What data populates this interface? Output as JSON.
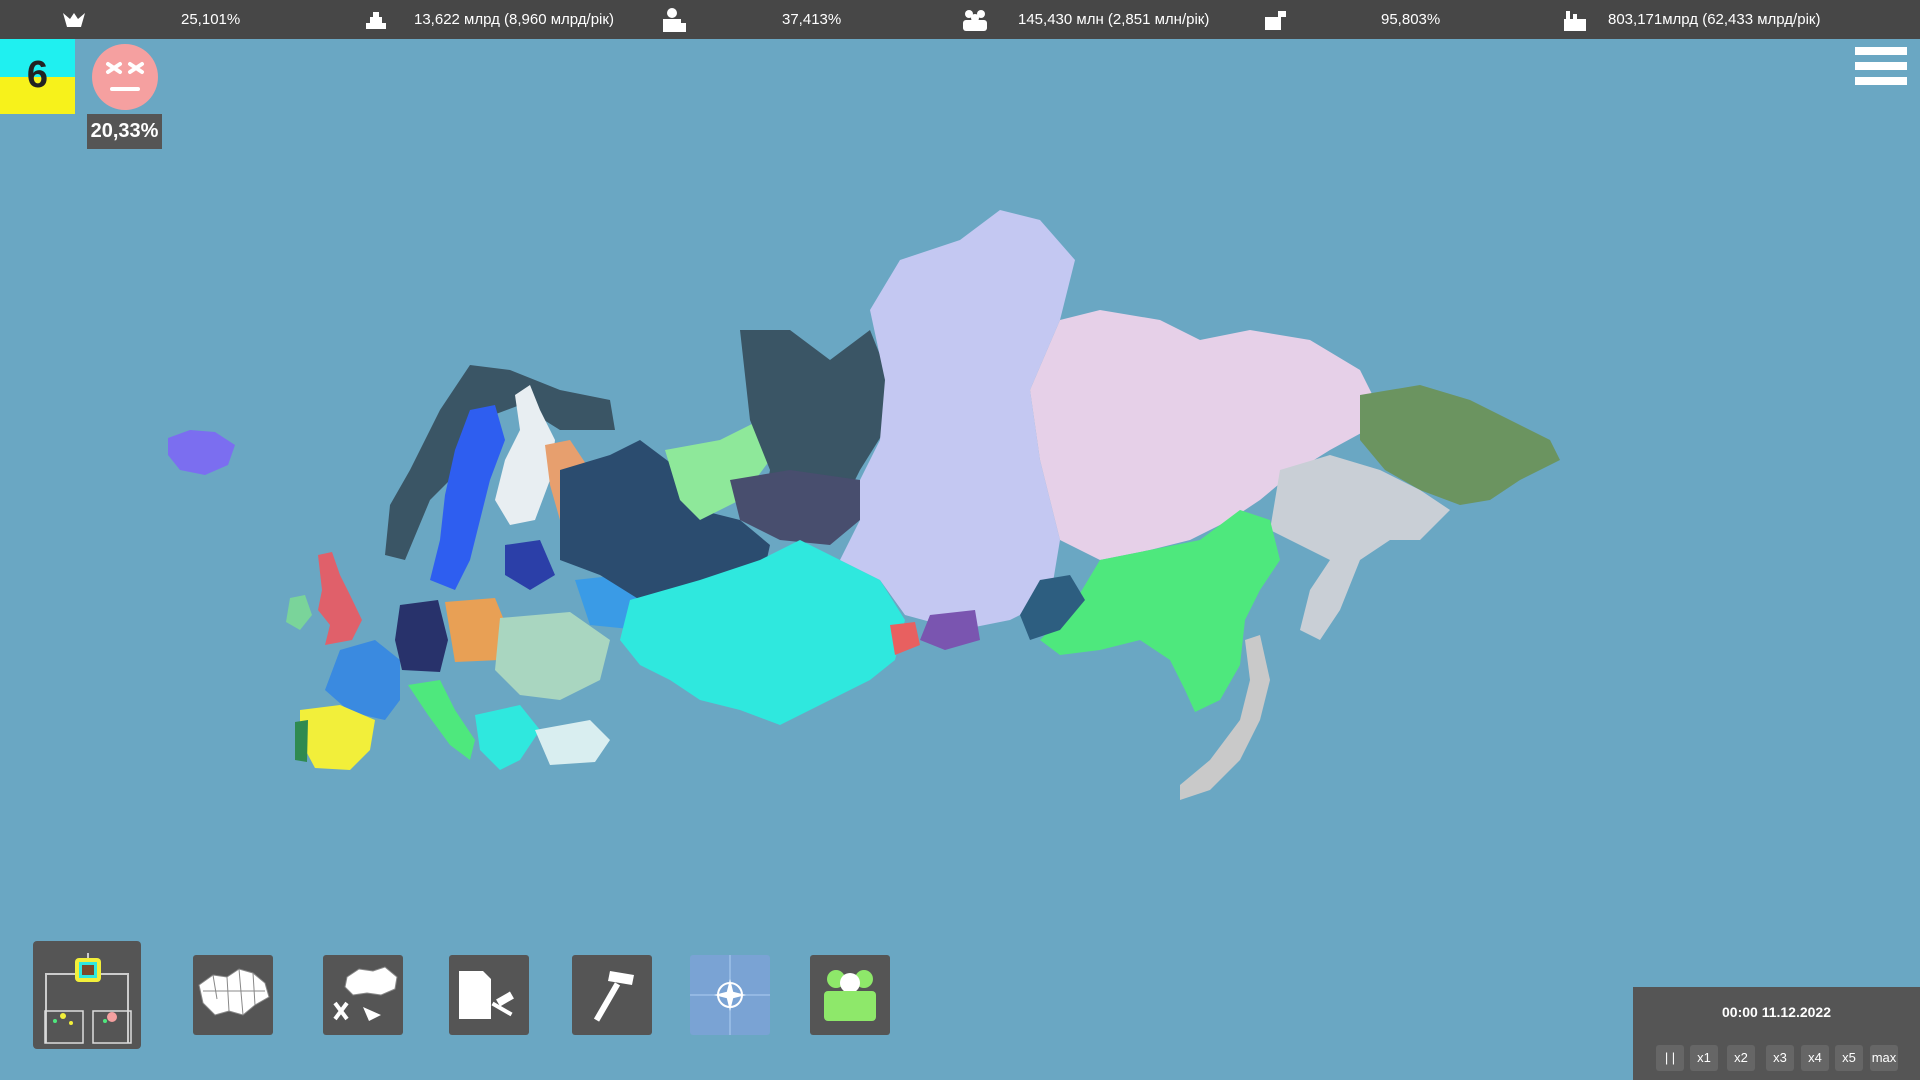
{
  "topbar": {
    "stats": [
      {
        "icon": "support-icon",
        "value": "25,101%"
      },
      {
        "icon": "budget-icon",
        "value": "13,622 млрд (8,960 млрд/рік)"
      },
      {
        "icon": "approval-icon",
        "value": "37,413%"
      },
      {
        "icon": "population-icon",
        "value": "145,430 млн (2,851 млн/рік)"
      },
      {
        "icon": "employment-icon",
        "value": "95,803%"
      },
      {
        "icon": "industry-icon",
        "value": "803,171млрд (62,433 млрд/рік)"
      }
    ]
  },
  "country": {
    "flag_number": "6",
    "flag_colors": {
      "top": "#1ff0f0",
      "bottom": "#f7f21b"
    },
    "mood_icon": "angry-face-icon",
    "unrest_percent": "20,33%"
  },
  "map": {
    "ocean_color": "#6aa7c3",
    "regions": [
      {
        "name": "russia-west",
        "color": "#2b4c6f"
      },
      {
        "name": "russia-north",
        "color": "#3a5565"
      },
      {
        "name": "russia-siberia",
        "color": "#c4c8f2"
      },
      {
        "name": "russia-east",
        "color": "#e6d0e8"
      },
      {
        "name": "kazakhstan",
        "color": "#2fe8de"
      },
      {
        "name": "chukotka",
        "color": "#6b9460"
      },
      {
        "name": "far-east-green",
        "color": "#4ee87d"
      },
      {
        "name": "scandinavia",
        "color": "#2e5ef0"
      },
      {
        "name": "iberia",
        "color": "#f2ef3a"
      },
      {
        "name": "japan",
        "color": "#c9c9c9"
      }
    ]
  },
  "toolbar": {
    "tools": [
      {
        "name": "tool-elections",
        "icon": "elections-icon"
      },
      {
        "name": "tool-regions",
        "icon": "ukraine-regions-icon"
      },
      {
        "name": "tool-region-actions",
        "icon": "regions-tools-icon"
      },
      {
        "name": "tool-laws",
        "icon": "law-gavel-icon"
      },
      {
        "name": "tool-build",
        "icon": "hammer-icon"
      },
      {
        "name": "tool-nato",
        "icon": "nato-icon"
      },
      {
        "name": "tool-people",
        "icon": "people-icon"
      }
    ]
  },
  "time": {
    "clock": "00:00 11.12.2022",
    "speeds": [
      "| |",
      "x1",
      "x2",
      "x3",
      "x4",
      "x5",
      "max"
    ]
  }
}
